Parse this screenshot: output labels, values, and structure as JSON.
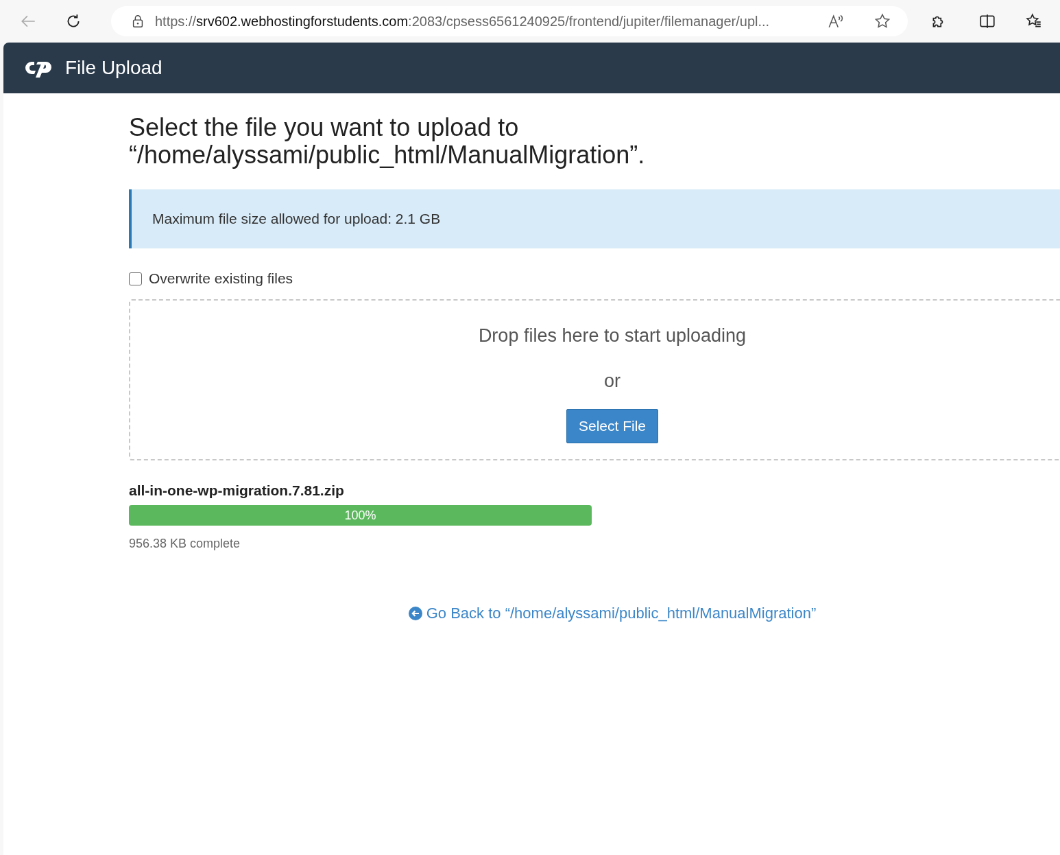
{
  "browser": {
    "url_scheme": "https://",
    "url_host": "srv602.webhostingforstudents.com",
    "url_rest": ":2083/cpsess6561240925/frontend/jupiter/filemanager/upl..."
  },
  "header": {
    "title": "File Upload"
  },
  "heading": {
    "line1": "Select the file you want to upload to",
    "line2": "“/home/alyssami/public_html/ManualMigration”."
  },
  "notice": "Maximum file size allowed for upload: 2.1 GB",
  "overwrite": {
    "label": "Overwrite existing files",
    "checked": false
  },
  "dropzone": {
    "prompt": "Drop files here to start uploading",
    "or": "or",
    "button": "Select File"
  },
  "uploads": [
    {
      "filename": "all-in-one-wp-migration.7.81.zip",
      "level": 1.0,
      "percent": "100%",
      "status": "956.38 KB complete"
    }
  ],
  "back_link": "Go Back to “/home/alyssami/public_html/ManualMigration”"
}
